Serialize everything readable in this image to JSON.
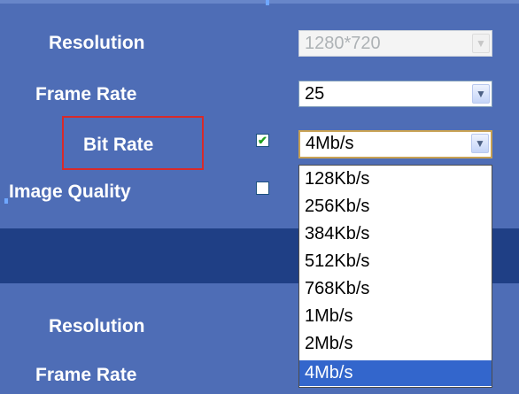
{
  "primary_stream": {
    "resolution": {
      "label": "Resolution",
      "value": "1280*720"
    },
    "frame_rate": {
      "label": "Frame Rate",
      "value": "25"
    },
    "bit_rate": {
      "label": "Bit Rate",
      "value": "4Mb/s",
      "checked": true,
      "check_glyph": "✔"
    },
    "image_quality": {
      "label": "Image Quality",
      "checked": false
    }
  },
  "bit_rate_options": [
    "128Kb/s",
    "256Kb/s",
    "384Kb/s",
    "512Kb/s",
    "768Kb/s",
    "1Mb/s",
    "2Mb/s",
    "4Mb/s"
  ],
  "secondary_stream": {
    "resolution": {
      "label": "Resolution"
    },
    "frame_rate": {
      "label": "Frame Rate"
    }
  },
  "icons": {
    "dropdown_arrow": "chevron-down-icon",
    "check": "checkmark-icon"
  },
  "colors": {
    "panel": "#4e6db6",
    "divider": "#1f3f85",
    "selected_option": "#3366cc",
    "highlight": "#d72a2a"
  }
}
